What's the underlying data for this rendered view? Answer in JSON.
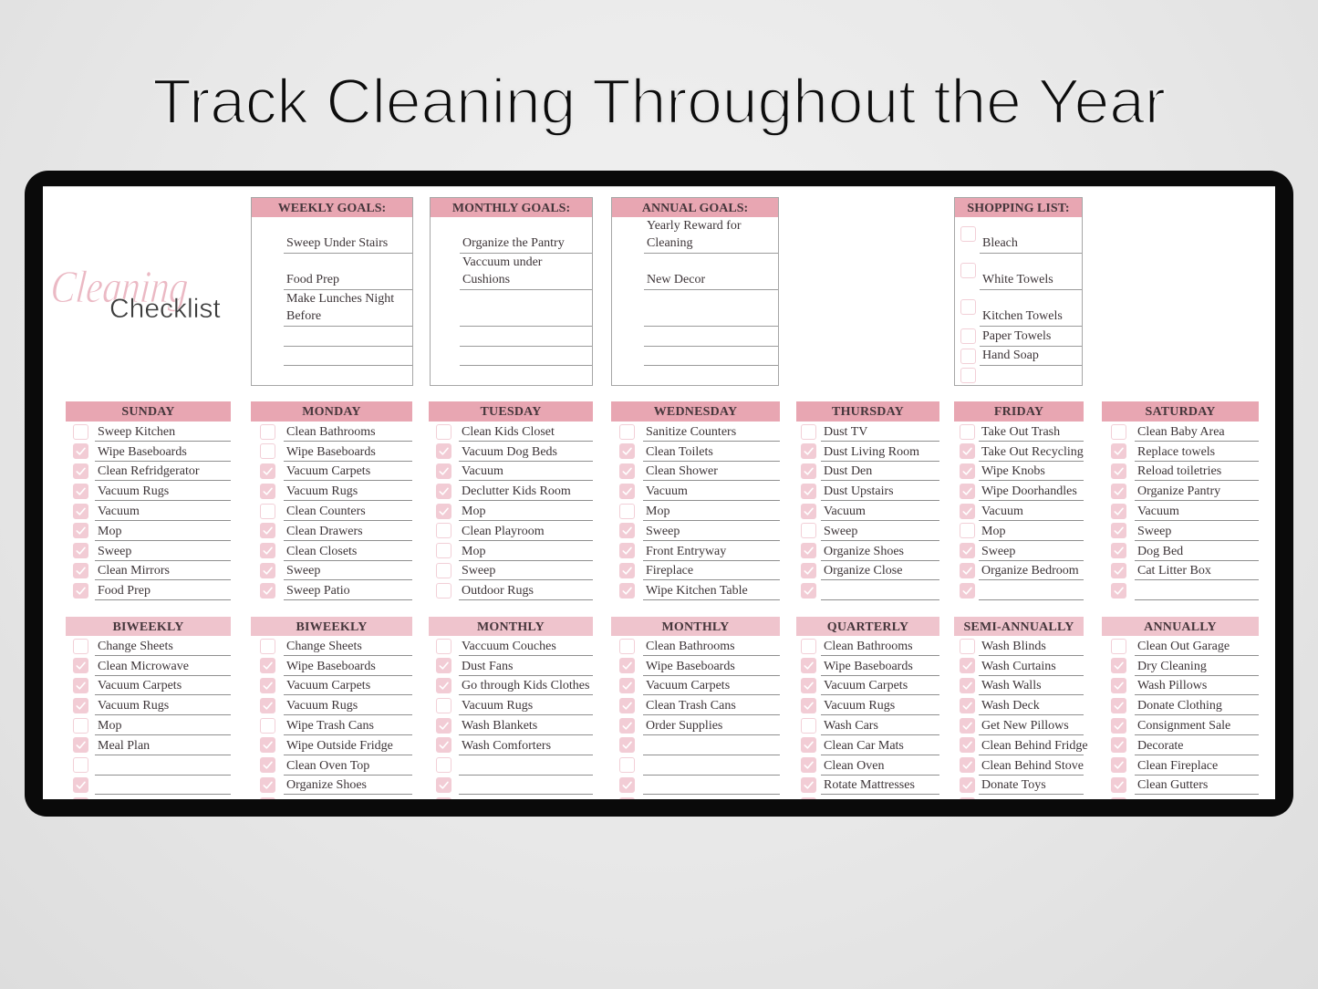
{
  "page": {
    "title": "Track Cleaning Throughout the Year"
  },
  "logo": {
    "script": "Cleaning",
    "word": "Checklist"
  },
  "colors": {
    "header_pink": "#e8a6b2",
    "periodic_header_pink": "#efc4cd",
    "checkbox_pink": "#f2ccd5",
    "logo_pink": "#ebb9c4",
    "device_frame": "#0a0a0a"
  },
  "goals": [
    {
      "title": "WEEKLY GOALS:",
      "items": [
        "Sweep Under Stairs",
        "Food Prep",
        "Make Lunches Night Before",
        "",
        "",
        ""
      ]
    },
    {
      "title": "MONTHLY GOALS:",
      "items": [
        "Organize the Pantry",
        "Vaccuum under Cushions",
        "",
        "",
        "",
        ""
      ]
    },
    {
      "title": "ANNUAL GOALS:",
      "items": [
        "Yearly Reward for Cleaning",
        "New Decor",
        "",
        "",
        "",
        ""
      ]
    }
  ],
  "shopping_list": {
    "title": "SHOPPING LIST:",
    "items": [
      {
        "label": "Bleach",
        "checked": false
      },
      {
        "label": "White Towels",
        "checked": false
      },
      {
        "label": "Kitchen Towels",
        "checked": false
      },
      {
        "label": "Paper Towels",
        "checked": false
      },
      {
        "label": "Hand Soap",
        "checked": false
      },
      {
        "label": "",
        "checked": false
      }
    ]
  },
  "daily": [
    {
      "title": "SUNDAY",
      "items": [
        {
          "label": "Sweep Kitchen",
          "checked": false
        },
        {
          "label": "Wipe Baseboards",
          "checked": true
        },
        {
          "label": "Clean Refridgerator",
          "checked": true
        },
        {
          "label": "Vacuum Rugs",
          "checked": true
        },
        {
          "label": "Vacuum",
          "checked": true
        },
        {
          "label": "Mop",
          "checked": true
        },
        {
          "label": "Sweep",
          "checked": true
        },
        {
          "label": "Clean Mirrors",
          "checked": true
        },
        {
          "label": "Food Prep",
          "checked": true
        }
      ]
    },
    {
      "title": "MONDAY",
      "items": [
        {
          "label": "Clean Bathrooms",
          "checked": false
        },
        {
          "label": "Wipe Baseboards",
          "checked": false
        },
        {
          "label": "Vacuum Carpets",
          "checked": true
        },
        {
          "label": "Vacuum Rugs",
          "checked": true
        },
        {
          "label": "Clean Counters",
          "checked": false
        },
        {
          "label": "Clean Drawers",
          "checked": true
        },
        {
          "label": "Clean Closets",
          "checked": true
        },
        {
          "label": "Sweep",
          "checked": true
        },
        {
          "label": "Sweep Patio",
          "checked": true
        }
      ]
    },
    {
      "title": "TUESDAY",
      "items": [
        {
          "label": "Clean Kids Closet",
          "checked": false
        },
        {
          "label": "Vacuum Dog Beds",
          "checked": true
        },
        {
          "label": "Vacuum",
          "checked": true
        },
        {
          "label": "Declutter Kids Room",
          "checked": true
        },
        {
          "label": "Mop",
          "checked": true
        },
        {
          "label": "Clean Playroom",
          "checked": false
        },
        {
          "label": "Mop",
          "checked": false
        },
        {
          "label": "Sweep",
          "checked": false
        },
        {
          "label": "Outdoor Rugs",
          "checked": false
        }
      ]
    },
    {
      "title": "WEDNESDAY",
      "items": [
        {
          "label": "Sanitize Counters",
          "checked": false
        },
        {
          "label": "Clean Toilets",
          "checked": true
        },
        {
          "label": "Clean Shower",
          "checked": true
        },
        {
          "label": "Vacuum",
          "checked": true
        },
        {
          "label": "Mop",
          "checked": false
        },
        {
          "label": "Sweep",
          "checked": true
        },
        {
          "label": "Front Entryway",
          "checked": true
        },
        {
          "label": "Fireplace",
          "checked": true
        },
        {
          "label": "Wipe Kitchen Table",
          "checked": true
        }
      ]
    },
    {
      "title": "THURSDAY",
      "items": [
        {
          "label": "Dust TV",
          "checked": false
        },
        {
          "label": "Dust Living Room",
          "checked": true
        },
        {
          "label": "Dust Den",
          "checked": true
        },
        {
          "label": "Dust Upstairs",
          "checked": true
        },
        {
          "label": "Vacuum",
          "checked": true
        },
        {
          "label": "Sweep",
          "checked": false
        },
        {
          "label": "Organize Shoes",
          "checked": true
        },
        {
          "label": "Organize Close",
          "checked": true
        },
        {
          "label": "",
          "checked": true
        }
      ]
    },
    {
      "title": "FRIDAY",
      "items": [
        {
          "label": "Take Out Trash",
          "checked": false
        },
        {
          "label": "Take Out Recycling",
          "checked": true
        },
        {
          "label": "Wipe Knobs",
          "checked": true
        },
        {
          "label": "Wipe Doorhandles",
          "checked": true
        },
        {
          "label": "Vacuum",
          "checked": true
        },
        {
          "label": "Mop",
          "checked": false
        },
        {
          "label": "Sweep",
          "checked": true
        },
        {
          "label": "Organize Bedroom",
          "checked": true
        },
        {
          "label": "",
          "checked": true
        }
      ]
    },
    {
      "title": "SATURDAY",
      "items": [
        {
          "label": "Clean Baby Area",
          "checked": false
        },
        {
          "label": "Replace towels",
          "checked": true
        },
        {
          "label": "Reload toiletries",
          "checked": true
        },
        {
          "label": "Organize Pantry",
          "checked": true
        },
        {
          "label": "Vacuum",
          "checked": true
        },
        {
          "label": "Sweep",
          "checked": true
        },
        {
          "label": "Dog Bed",
          "checked": true
        },
        {
          "label": "Cat Litter Box",
          "checked": true
        },
        {
          "label": "",
          "checked": true
        }
      ]
    }
  ],
  "periodic": [
    {
      "title": "BIWEEKLY",
      "items": [
        {
          "label": "Change Sheets",
          "checked": false
        },
        {
          "label": "Clean Microwave",
          "checked": true
        },
        {
          "label": "Vacuum Carpets",
          "checked": true
        },
        {
          "label": "Vacuum Rugs",
          "checked": true
        },
        {
          "label": "Mop",
          "checked": false
        },
        {
          "label": "Meal Plan",
          "checked": true
        },
        {
          "label": "",
          "checked": false
        },
        {
          "label": "",
          "checked": true
        },
        {
          "label": "",
          "checked": true
        }
      ]
    },
    {
      "title": "BIWEEKLY",
      "items": [
        {
          "label": "Change Sheets",
          "checked": false
        },
        {
          "label": "Wipe Baseboards",
          "checked": true
        },
        {
          "label": "Vacuum Carpets",
          "checked": true
        },
        {
          "label": "Vacuum Rugs",
          "checked": true
        },
        {
          "label": "Wipe Trash Cans",
          "checked": false
        },
        {
          "label": "Wipe Outside Fridge",
          "checked": true
        },
        {
          "label": "Clean Oven Top",
          "checked": true
        },
        {
          "label": "Organize Shoes",
          "checked": true
        },
        {
          "label": "",
          "checked": true
        }
      ]
    },
    {
      "title": "MONTHLY",
      "items": [
        {
          "label": "Vaccuum Couches",
          "checked": false
        },
        {
          "label": "Dust Fans",
          "checked": true
        },
        {
          "label": "Go through Kids Clothes",
          "checked": true
        },
        {
          "label": "Vacuum Rugs",
          "checked": false
        },
        {
          "label": "Wash Blankets",
          "checked": true
        },
        {
          "label": "Wash Comforters",
          "checked": true
        },
        {
          "label": "",
          "checked": false
        },
        {
          "label": "",
          "checked": true
        },
        {
          "label": "",
          "checked": true
        }
      ]
    },
    {
      "title": "MONTHLY",
      "items": [
        {
          "label": "Clean Bathrooms",
          "checked": false
        },
        {
          "label": "Wipe Baseboards",
          "checked": true
        },
        {
          "label": "Vacuum Carpets",
          "checked": true
        },
        {
          "label": "Clean Trash Cans",
          "checked": true
        },
        {
          "label": "Order Supplies",
          "checked": true
        },
        {
          "label": "",
          "checked": true
        },
        {
          "label": "",
          "checked": false
        },
        {
          "label": "",
          "checked": true
        },
        {
          "label": "",
          "checked": true
        }
      ]
    },
    {
      "title": "QUARTERLY",
      "items": [
        {
          "label": "Clean Bathrooms",
          "checked": false
        },
        {
          "label": "Wipe Baseboards",
          "checked": true
        },
        {
          "label": "Vacuum Carpets",
          "checked": true
        },
        {
          "label": "Vacuum Rugs",
          "checked": true
        },
        {
          "label": "Wash Cars",
          "checked": false
        },
        {
          "label": "Clean Car Mats",
          "checked": true
        },
        {
          "label": "Clean Oven",
          "checked": true
        },
        {
          "label": "Rotate Mattresses",
          "checked": true
        },
        {
          "label": "",
          "checked": true
        }
      ]
    },
    {
      "title": "SEMI-ANNUALLY",
      "items": [
        {
          "label": "Wash Blinds",
          "checked": false
        },
        {
          "label": "Wash Curtains",
          "checked": true
        },
        {
          "label": "Wash Walls",
          "checked": true
        },
        {
          "label": "Wash Deck",
          "checked": true
        },
        {
          "label": "Get New Pillows",
          "checked": true
        },
        {
          "label": "Clean Behind Fridge",
          "checked": true
        },
        {
          "label": "Clean Behind Stove",
          "checked": true
        },
        {
          "label": "Donate Toys",
          "checked": true
        },
        {
          "label": "",
          "checked": true
        }
      ]
    },
    {
      "title": "ANNUALLY",
      "items": [
        {
          "label": "Clean Out Garage",
          "checked": false
        },
        {
          "label": "Dry Cleaning",
          "checked": true
        },
        {
          "label": "Wash Pillows",
          "checked": true
        },
        {
          "label": "Donate Clothing",
          "checked": true
        },
        {
          "label": "Consignment Sale",
          "checked": true
        },
        {
          "label": "Decorate",
          "checked": true
        },
        {
          "label": "Clean Fireplace",
          "checked": true
        },
        {
          "label": "Clean Gutters",
          "checked": true
        },
        {
          "label": "",
          "checked": true
        }
      ]
    }
  ]
}
